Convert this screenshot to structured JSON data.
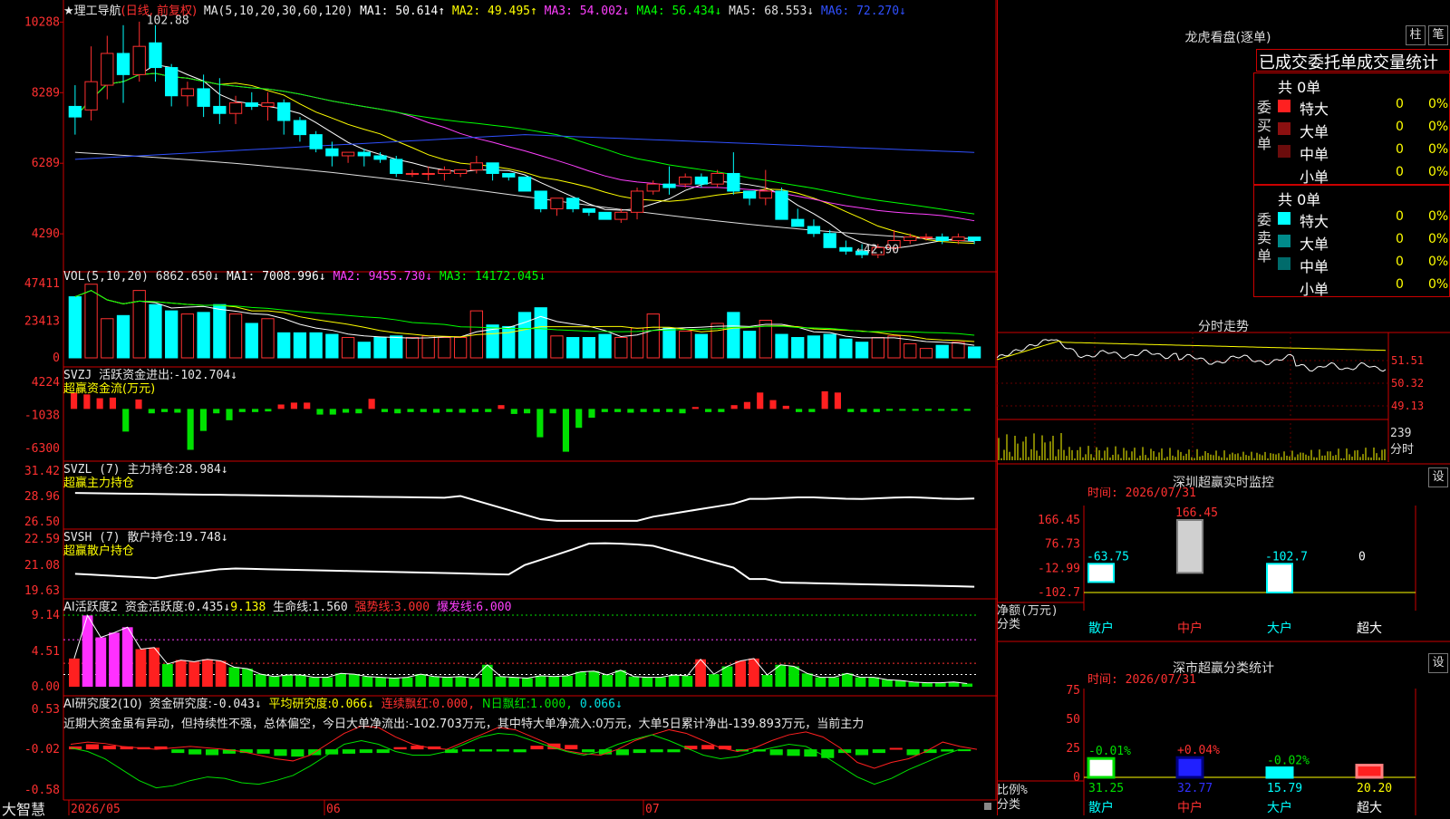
{
  "kline": {
    "stock_name": "★理工导航",
    "mode": "(日线, 前复权)",
    "ma_title": "MA(5,10,20,30,60,120)",
    "ma": [
      {
        "label": "MA1:",
        "value": "50.614↑",
        "color": "#ffffff"
      },
      {
        "label": "MA2:",
        "value": "49.495↑",
        "color": "#ffff00"
      },
      {
        "label": "MA3:",
        "value": "54.002↓",
        "color": "#ff40ff"
      },
      {
        "label": "MA4:",
        "value": "56.434↓",
        "color": "#00ff00"
      },
      {
        "label": "MA5:",
        "value": "68.553↓",
        "color": "#e0e0e0"
      },
      {
        "label": "MA6:",
        "value": "72.270↓",
        "color": "#3050ff"
      }
    ],
    "y_ticks": [
      "10288",
      "8289",
      "6289",
      "4290"
    ],
    "high_marker": "102.88",
    "low_marker": "←42.90",
    "candles": [
      [
        79,
        76,
        85,
        71
      ],
      [
        78,
        86,
        96,
        75
      ],
      [
        85,
        94,
        99,
        81
      ],
      [
        94,
        88,
        102,
        80
      ],
      [
        88,
        96,
        103,
        86
      ],
      [
        97,
        90,
        102,
        86
      ],
      [
        90,
        82,
        91,
        79
      ],
      [
        82,
        84,
        86,
        79
      ],
      [
        84,
        79,
        88,
        76
      ],
      [
        79,
        77,
        87,
        74
      ],
      [
        77,
        80,
        82,
        74
      ],
      [
        80,
        79,
        83,
        78
      ],
      [
        79,
        80,
        83,
        75
      ],
      [
        80,
        75,
        81,
        71
      ],
      [
        75,
        71,
        76,
        69
      ],
      [
        71,
        67,
        72,
        66
      ],
      [
        67,
        65,
        69,
        62
      ],
      [
        65,
        66,
        66,
        63
      ],
      [
        66,
        65,
        67,
        62
      ],
      [
        65,
        64,
        66,
        63
      ],
      [
        64,
        60,
        65,
        59
      ],
      [
        60,
        60,
        61,
        59
      ],
      [
        60,
        60,
        62,
        58
      ],
      [
        60,
        61,
        62,
        58
      ],
      [
        60,
        61,
        61,
        59
      ],
      [
        61,
        63,
        65,
        60
      ],
      [
        63,
        60,
        63,
        58
      ],
      [
        60,
        59,
        60,
        58
      ],
      [
        59,
        55,
        59,
        55
      ],
      [
        55,
        50,
        55,
        49
      ],
      [
        50,
        53,
        53,
        48
      ],
      [
        53,
        50,
        53,
        49
      ],
      [
        50,
        49,
        50,
        48
      ],
      [
        49,
        47,
        49,
        47
      ],
      [
        47,
        49,
        50,
        46
      ],
      [
        49,
        55,
        56,
        47
      ],
      [
        55,
        57,
        58,
        54
      ],
      [
        57,
        56,
        62,
        54
      ],
      [
        57,
        59,
        60,
        56
      ],
      [
        59,
        57,
        60,
        56
      ],
      [
        57,
        60,
        61,
        56
      ],
      [
        60,
        55,
        66,
        54
      ],
      [
        55,
        53,
        55,
        51
      ],
      [
        53,
        55,
        61,
        51
      ],
      [
        55,
        47,
        56,
        47
      ],
      [
        47,
        45,
        50,
        45
      ],
      [
        45,
        43,
        47,
        42
      ],
      [
        43,
        39,
        44,
        39
      ],
      [
        39,
        38,
        41,
        37
      ],
      [
        38,
        37,
        40,
        36
      ],
      [
        37,
        39,
        40,
        36
      ],
      [
        39,
        41,
        44,
        38
      ],
      [
        41,
        42,
        43,
        40
      ],
      [
        42,
        42,
        43,
        41
      ],
      [
        42,
        41,
        43,
        40
      ],
      [
        41,
        42,
        43,
        40
      ],
      [
        42,
        41,
        42,
        40
      ]
    ]
  },
  "vol": {
    "title": "VOL(5,10,20)",
    "value": "6862.650↓",
    "ma": [
      {
        "label": "MA1:",
        "value": "7008.996↓",
        "color": "#ffffff"
      },
      {
        "label": "MA2:",
        "value": "9455.730↓",
        "color": "#ff40ff"
      },
      {
        "label": "MA3:",
        "value": "14172.045↓",
        "color": "#00ff00"
      }
    ],
    "y_ticks": [
      "47411",
      "23413",
      "0"
    ],
    "values": [
      39,
      47,
      25,
      27,
      43,
      34,
      30,
      28,
      29,
      34,
      28,
      22,
      25,
      16,
      16,
      16,
      15,
      13,
      10,
      13,
      14,
      13,
      14,
      13,
      13,
      30,
      21,
      20,
      29,
      32,
      14,
      13,
      13,
      15,
      13,
      19,
      28,
      19,
      17,
      15,
      22,
      29,
      17,
      24,
      15,
      13,
      14,
      15,
      12,
      10,
      13,
      14,
      9,
      6,
      8,
      10,
      7
    ]
  },
  "svzj": {
    "title": "SVZJ",
    "label": "活跃资金进出:",
    "value": "-102.704↓",
    "sub": "超赢资金流(万元)",
    "y_ticks": [
      "4224",
      "-1038",
      "-6300"
    ],
    "values": [
      2600,
      2300,
      1700,
      1800,
      -3600,
      1500,
      -700,
      -500,
      -600,
      -6500,
      -3500,
      -700,
      -1800,
      -500,
      -500,
      -400,
      700,
      1000,
      1000,
      -900,
      -900,
      -600,
      -700,
      1600,
      -500,
      -700,
      -500,
      -500,
      -600,
      -500,
      -600,
      -500,
      -500,
      600,
      -800,
      -700,
      -4500,
      -700,
      -6800,
      -3000,
      -1400,
      -500,
      -500,
      -600,
      -500,
      -500,
      -500,
      -700,
      300,
      -500,
      -500,
      600,
      1100,
      2600,
      1400,
      500,
      -500,
      -500,
      2800,
      2600,
      -500,
      -500,
      -500,
      -300,
      -300,
      -300,
      -300,
      -300,
      -300,
      -300
    ]
  },
  "svzl": {
    "title": "SVZL (7)",
    "label": "主力持仓:",
    "value": "28.984↓",
    "sub": "超赢主力持仓",
    "y_ticks": [
      "31.42",
      "28.96",
      "26.50"
    ]
  },
  "svsh": {
    "title": "SVSH (7)",
    "label": "散户持仓:",
    "value": "19.748↓",
    "sub": "超赢散户持仓",
    "y_ticks": [
      "22.59",
      "21.08",
      "19.63"
    ]
  },
  "ai_active": {
    "title": "AI活跃度2",
    "label": "资金活跃度:",
    "value1": "0.435↓",
    "value2": "9.138",
    "life_label": "生命线:",
    "life_value": "1.560",
    "strong_label": "强势线:",
    "strong_value": "3.000",
    "burst_label": "爆发线:",
    "burst_value": "6.000",
    "y_ticks": [
      "9.14",
      "4.51",
      "0.00"
    ],
    "values": [
      3.6,
      9.1,
      6.3,
      6.9,
      7.6,
      4.8,
      5.0,
      2.9,
      3.4,
      3.2,
      3.5,
      3.3,
      2.5,
      2.3,
      1.6,
      1.3,
      1.5,
      1.5,
      1.2,
      1.2,
      1.7,
      1.6,
      1.3,
      1.2,
      1.1,
      1.2,
      1.6,
      1.3,
      1.2,
      1.3,
      1.1,
      2.8,
      1.3,
      1.2,
      1.1,
      1.4,
      1.3,
      1.4,
      1.9,
      2.0,
      1.5,
      2.1,
      1.3,
      1.2,
      1.2,
      1.5,
      1.4,
      3.5,
      1.6,
      2.6,
      3.3,
      3.6,
      1.5,
      2.8,
      2.6,
      1.7,
      1.2,
      1.2,
      1.7,
      1.2,
      1.2,
      0.9,
      0.8,
      0.6,
      0.5,
      0.5,
      0.6,
      0.4
    ],
    "magenta_count": 6
  },
  "ai_research": {
    "title": "AI研究度2(10)",
    "label": "资金研究度:",
    "value": "-0.043↓",
    "avg_label": "平均研究度:",
    "avg_value": "0.066↓",
    "lian_label": "连续飘红:",
    "lian_value": "0.000,",
    "n_label": "N日飘红:",
    "n_value": "1.000,",
    "last": "0.066↓",
    "y_ticks": [
      "0.53",
      "-0.02",
      "-0.58"
    ],
    "comment": "近期大资金虽有异动，但持续性不强，总体偏空，今日大单净流出:-102.703万元，其中特大单净流入:0万元，大单5日累计净出-139.893万元，当前主力",
    "values": [
      0.04,
      0.07,
      0.05,
      0.04,
      0.03,
      0.04,
      -0.05,
      -0.07,
      -0.08,
      -0.06,
      -0.05,
      -0.06,
      -0.09,
      -0.1,
      -0.08,
      -0.07,
      -0.06,
      -0.05,
      -0.05,
      0.03,
      0.05,
      0.04,
      -0.05,
      -0.03,
      -0.03,
      -0.03,
      -0.04,
      0.05,
      0.08,
      0.06,
      -0.04,
      -0.07,
      -0.08,
      -0.05,
      -0.04,
      -0.04,
      0.05,
      0.06,
      0.05,
      -0.03,
      -0.03,
      -0.08,
      -0.09,
      -0.1,
      -0.12,
      -0.05,
      -0.08,
      -0.05,
      0.02,
      -0.08,
      -0.05,
      -0.03,
      -0.02
    ],
    "red_line": [
      0.05,
      0.08,
      0.06,
      0.02,
      0.0,
      -0.02,
      0.0,
      0.02,
      0.0,
      -0.02,
      -0.05,
      -0.1,
      -0.15,
      -0.18,
      -0.1,
      0.05,
      0.2,
      0.3,
      0.28,
      0.15,
      0.05,
      0.0,
      -0.02,
      0.08,
      0.18,
      0.28,
      0.25,
      0.15,
      0.05,
      -0.04,
      -0.08,
      -0.1,
      -0.02,
      0.1,
      0.18,
      0.25,
      0.2,
      0.1,
      0.0,
      -0.05,
      0.0,
      0.1,
      0.18,
      0.22,
      0.15,
      0.0,
      -0.2,
      -0.28,
      -0.2,
      -0.15,
      -0.05,
      0.08,
      0.02,
      -0.02
    ],
    "green_line": [
      0.0,
      -0.05,
      -0.15,
      -0.3,
      -0.45,
      -0.55,
      -0.52,
      -0.45,
      -0.4,
      -0.42,
      -0.48,
      -0.5,
      -0.45,
      -0.38,
      -0.25,
      -0.1,
      0.05,
      0.1,
      0.05,
      -0.05,
      -0.1,
      -0.1,
      -0.05,
      0.05,
      0.15,
      0.2,
      0.18,
      0.1,
      0.02,
      -0.05,
      -0.1,
      -0.05,
      0.05,
      0.12,
      0.18,
      0.1,
      0.0,
      -0.1,
      -0.15,
      -0.12,
      -0.05,
      0.0,
      0.05,
      0.02,
      -0.1,
      -0.25,
      -0.4,
      -0.5,
      -0.42,
      -0.3,
      -0.2,
      -0.1,
      -0.02
    ]
  },
  "bottom": {
    "brand": "大智慧",
    "dates": [
      "2026/05",
      "06",
      "07"
    ]
  },
  "dragon": {
    "title": "龙虎看盘(逐单)",
    "btn_zhu": "柱",
    "btn_bi": "笔",
    "header": "已成交委托单成交量统计",
    "buy": {
      "label_chars": [
        "委",
        "买",
        "单"
      ],
      "total": "共 0单",
      "rows": [
        {
          "name": "特大",
          "count": "0",
          "pct": "0%",
          "color": "#ff2020"
        },
        {
          "name": "大单",
          "count": "0",
          "pct": "0%",
          "color": "#8b1010"
        },
        {
          "name": "中单",
          "count": "0",
          "pct": "0%",
          "color": "#6b0c0c"
        },
        {
          "name": "小单",
          "count": "0",
          "pct": "0%",
          "color": "#000000"
        }
      ]
    },
    "sell": {
      "label_chars": [
        "委",
        "卖",
        "单"
      ],
      "total": "共 0单",
      "rows": [
        {
          "name": "特大",
          "count": "0",
          "pct": "0%",
          "color": "#00ffff"
        },
        {
          "name": "大单",
          "count": "0",
          "pct": "0%",
          "color": "#008b8b"
        },
        {
          "name": "中单",
          "count": "0",
          "pct": "0%",
          "color": "#006b6b"
        },
        {
          "name": "小单",
          "count": "0",
          "pct": "0%",
          "color": "#000000"
        }
      ]
    }
  },
  "intraday": {
    "title": "分时走势",
    "y_ticks": [
      "51.51",
      "50.32",
      "49.13"
    ],
    "vol_label": "239",
    "vol_unit": "分时"
  },
  "sz_monitor": {
    "title": "深圳超赢实时监控",
    "btn": "设",
    "time_label": "时间: 2026/07/31",
    "y_ticks": [
      "166.45",
      "76.73",
      "-12.99",
      "-102.7"
    ],
    "unit_label": "净额(万元)",
    "class_label": "分类",
    "cats": [
      "散户",
      "中户",
      "大户",
      "超大"
    ],
    "values": [
      -63.75,
      166.45,
      -102.7,
      0
    ],
    "value_labels": [
      "-63.75",
      "166.45",
      "-102.7",
      "0"
    ]
  },
  "sz_class": {
    "title": "深市超赢分类统计",
    "btn": "设",
    "time_label": "时间: 2026/07/31",
    "y_ticks": [
      "75",
      "50",
      "25",
      "0"
    ],
    "ratio_label": "比例%",
    "class_label": "分类",
    "cats": [
      "散户",
      "中户",
      "大户",
      "超大"
    ],
    "values": [
      31.25,
      32.77,
      15.79,
      20.2
    ],
    "value_labels": [
      "31.25",
      "32.77",
      "15.79",
      "20.20"
    ],
    "change_labels": [
      "-0.01%",
      "+0.04%",
      "-0.02%",
      ""
    ],
    "colors": [
      "#ffffff",
      "#2020ff",
      "#00ffff",
      "#ff2020"
    ]
  }
}
